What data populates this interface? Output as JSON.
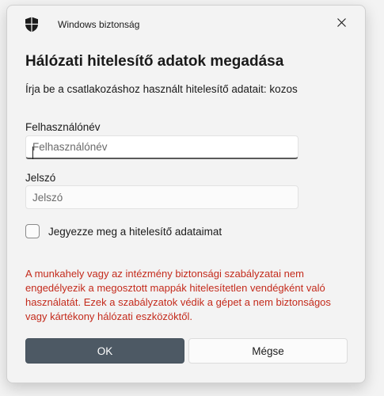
{
  "window": {
    "app_title": "Windows biztonság",
    "shield_icon": "shield-icon",
    "close_icon": "close-icon"
  },
  "dialog": {
    "heading": "Hálózati hitelesítő adatok megadása",
    "subtitle": "Írja be a csatlakozáshoz használt hitelesítő adatait: kozos"
  },
  "username": {
    "label": "Felhasználónév",
    "placeholder": "Felhasználónév",
    "value": ""
  },
  "password": {
    "label": "Jelszó",
    "placeholder": "Jelszó",
    "value": ""
  },
  "remember": {
    "label": "Jegyezze meg a hitelesítő adataimat",
    "checked": false
  },
  "error": {
    "message": "A munkahely vagy az intézmény biztonsági szabályzatai nem engedélyezik a megosztott mappák hitelesítetlen vendégként való használatát. Ezek a szabályzatok védik a gépet a nem biztonságos vagy kártékony hálózati eszközöktől.",
    "color": "#c42b1c"
  },
  "buttons": {
    "ok_label": "OK",
    "cancel_label": "Mégse",
    "ok_color": "#4d5964"
  }
}
